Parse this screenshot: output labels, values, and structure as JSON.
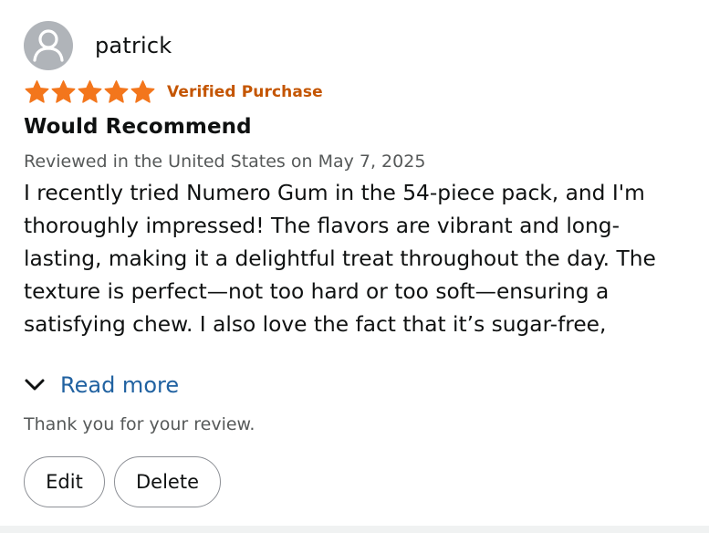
{
  "review": {
    "reviewer_name": "patrick",
    "rating": 5,
    "max_rating": 5,
    "verified_label": "Verified Purchase",
    "title": "Would Recommend",
    "meta": "Reviewed in the United States on May 7, 2025",
    "body": "I recently tried Numero Gum in the 54-piece pack, and I'm thoroughly impressed! The flavors are vibrant and long-lasting, making it a delightful treat throughout the day. The texture is perfect—not too hard or too soft—ensuring a satisfying chew. I also love the fact that it’s sugar-free,"
  },
  "read_more": {
    "label": "Read more",
    "icon": "chevron-down-icon"
  },
  "thanks_text": "Thank you for your review.",
  "actions": {
    "edit_label": "Edit",
    "delete_label": "Delete"
  },
  "colors": {
    "star": "#f3761c",
    "verified": "#c45500",
    "link": "#2162a1",
    "meta": "#565959",
    "avatar": "#b0b4b9"
  }
}
